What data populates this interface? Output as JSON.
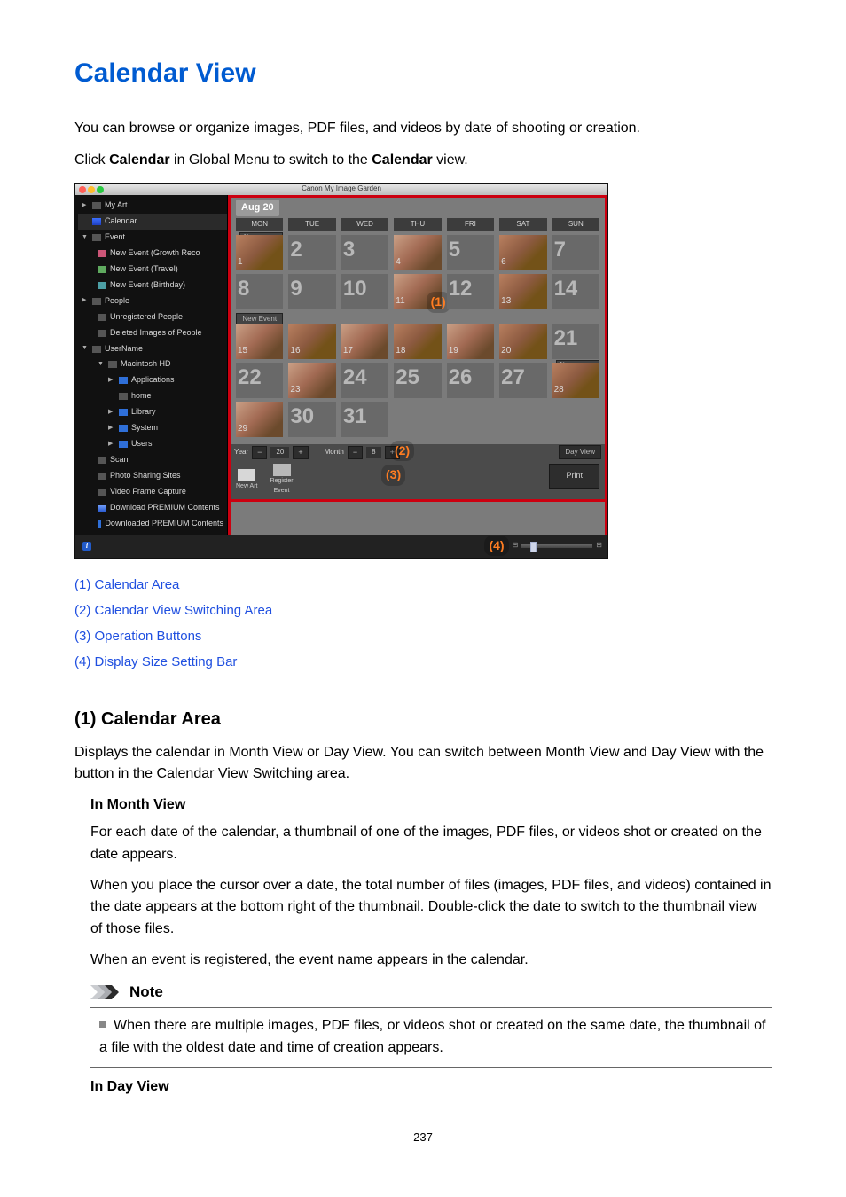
{
  "title": "Calendar View",
  "intro1_pre": "You can browse or organize images, PDF files, and videos by date of shooting or creation.",
  "intro2_pre": "Click ",
  "intro2_b1": "Calendar",
  "intro2_mid": " in Global Menu to switch to the ",
  "intro2_b2": "Calendar",
  "intro2_post": " view.",
  "shot": {
    "window_title": "Canon My Image Garden",
    "side": {
      "myart": "My Art",
      "calendar": "Calendar",
      "event": "Event",
      "event_growth": "New Event (Growth Reco",
      "event_travel": "New Event (Travel)",
      "event_birthday": "New Event (Birthday)",
      "people": "People",
      "unreg": "Unregistered People",
      "deleted": "Deleted Images of People",
      "username": "UserName",
      "machd": "Macintosh HD",
      "apps": "Applications",
      "home": "home",
      "library": "Library",
      "system": "System",
      "users": "Users",
      "scan": "Scan",
      "sharing": "Photo Sharing Sites",
      "vfc": "Video Frame Capture",
      "dlprem": "Download PREMIUM Contents",
      "dledprem": "Downloaded PREMIUM Contents"
    },
    "month": "Aug 20",
    "dow": [
      "MON",
      "TUE",
      "WED",
      "THU",
      "FRI",
      "SAT",
      "SUN"
    ],
    "event_tag": "New Event...",
    "event_bar": "New Event (Travel)",
    "days": {
      "d2": "2",
      "d3": "3",
      "d5": "5",
      "d7": "7",
      "d8": "8",
      "d9": "9",
      "d10": "10",
      "d12": "12",
      "d14": "14",
      "d21": "21",
      "d22": "22",
      "d24": "24",
      "d25": "25",
      "d26": "26",
      "d27": "27",
      "d30": "30",
      "d31": "31",
      "s1": "1",
      "s4": "4",
      "s6": "6",
      "s11": "11",
      "s13": "13",
      "s15": "15",
      "s16": "16",
      "s17": "17",
      "s18": "18",
      "s19": "19",
      "s20": "20",
      "s23": "23",
      "s28": "28",
      "s29": "29"
    },
    "year_label": "Year",
    "year_val": "20",
    "month_label": "Month",
    "month_val": "8",
    "minus": "−",
    "plus": "+",
    "dayview": "Day View",
    "newart": "New Art",
    "register": "Register\nEvent",
    "print": "Print",
    "bubble1": "(1)",
    "bubble2": "(2)",
    "bubble3": "(3)",
    "bubble4": "(4)"
  },
  "links": {
    "l1": "(1) Calendar Area",
    "l2": "(2) Calendar View Switching Area",
    "l3": "(3) Operation Buttons",
    "l4": "(4) Display Size Setting Bar"
  },
  "s1": {
    "heading": "(1) Calendar Area",
    "p": "Displays the calendar in Month View or Day View. You can switch between Month View and Day View with the button in the Calendar View Switching area.",
    "dt1": "In Month View",
    "dd1a": "For each date of the calendar, a thumbnail of one of the images, PDF files, or videos shot or created on the date appears.",
    "dd1b": "When you place the cursor over a date, the total number of files (images, PDF files, and videos) contained in the date appears at the bottom right of the thumbnail. Double-click the date to switch to the thumbnail view of those files.",
    "dd1c": "When an event is registered, the event name appears in the calendar.",
    "note_label": "Note",
    "note_item": "When there are multiple images, PDF files, or videos shot or created on the same date, the thumbnail of a file with the oldest date and time of creation appears.",
    "dt2": "In Day View"
  },
  "page_num": "237"
}
